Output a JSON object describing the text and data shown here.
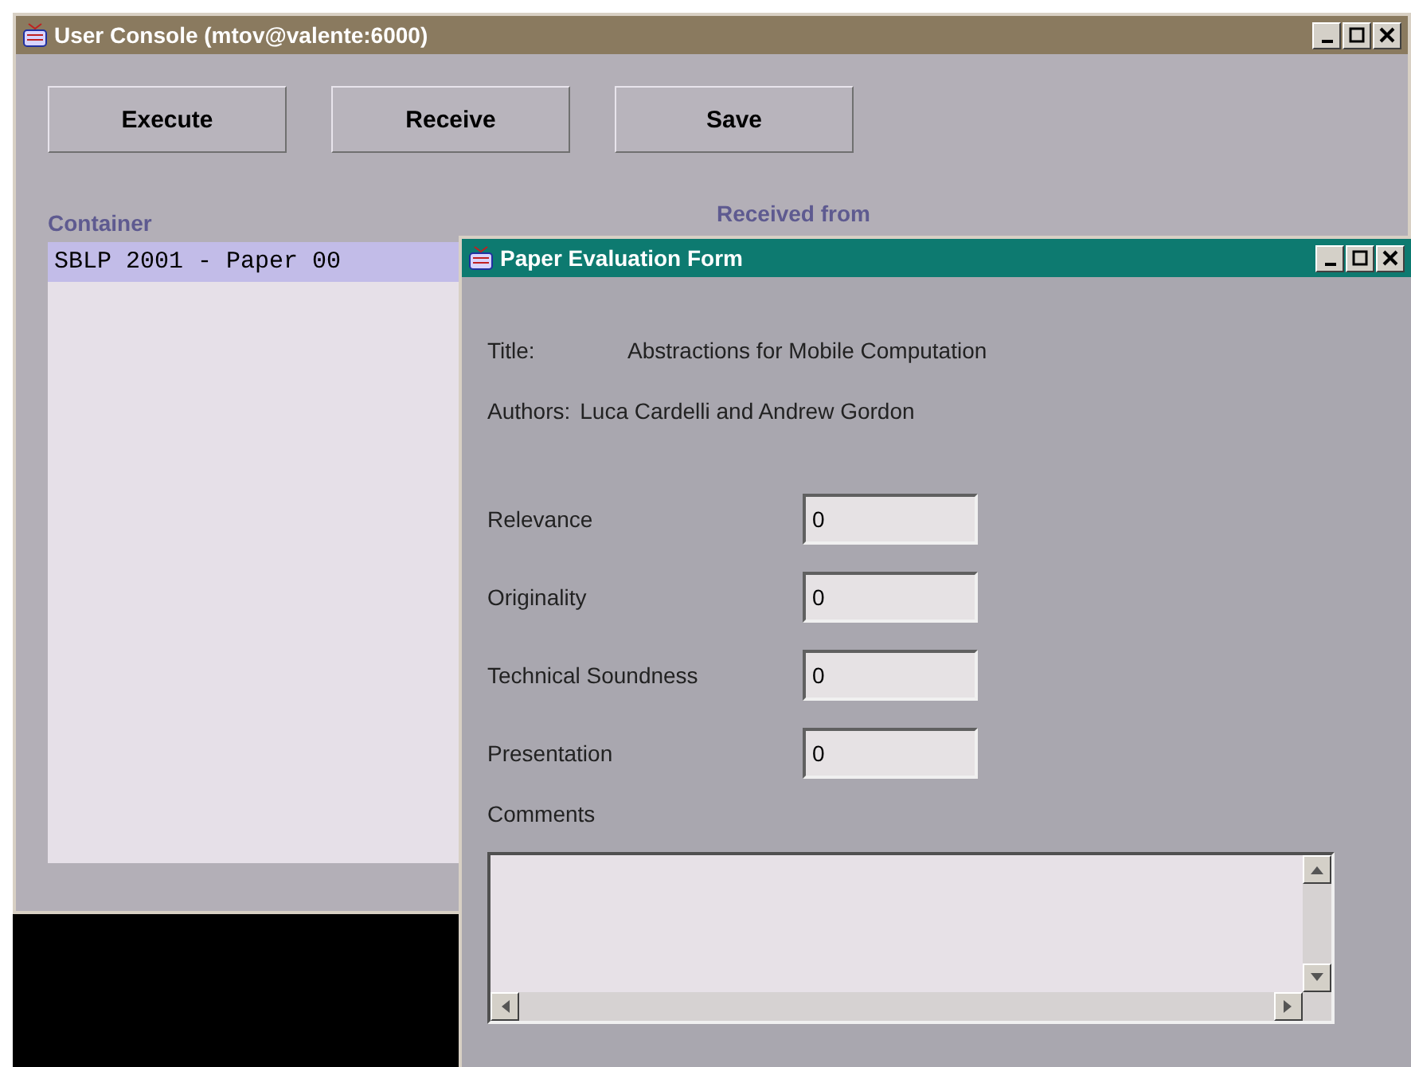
{
  "console": {
    "title": "User Console (mtov@valente:6000)",
    "buttons": [
      "Execute",
      "Receive",
      "Save"
    ],
    "container_label": "Container",
    "received_label": "Received from",
    "container_items": [
      {
        "text": "SBLP 2001 - Paper 00",
        "selected": true
      }
    ]
  },
  "form": {
    "title": "Paper Evaluation Form",
    "info": [
      {
        "label": "Title:",
        "value": "Abstractions for Mobile Computation"
      },
      {
        "label": "Authors:",
        "value": "Luca Cardelli and Andrew Gordon"
      }
    ],
    "fields": [
      {
        "label": "Relevance",
        "value": "0"
      },
      {
        "label": "Originality",
        "value": "0"
      },
      {
        "label": "Technical Soundness",
        "value": "0"
      },
      {
        "label": "Presentation",
        "value": "0"
      }
    ],
    "comments_label": "Comments"
  }
}
